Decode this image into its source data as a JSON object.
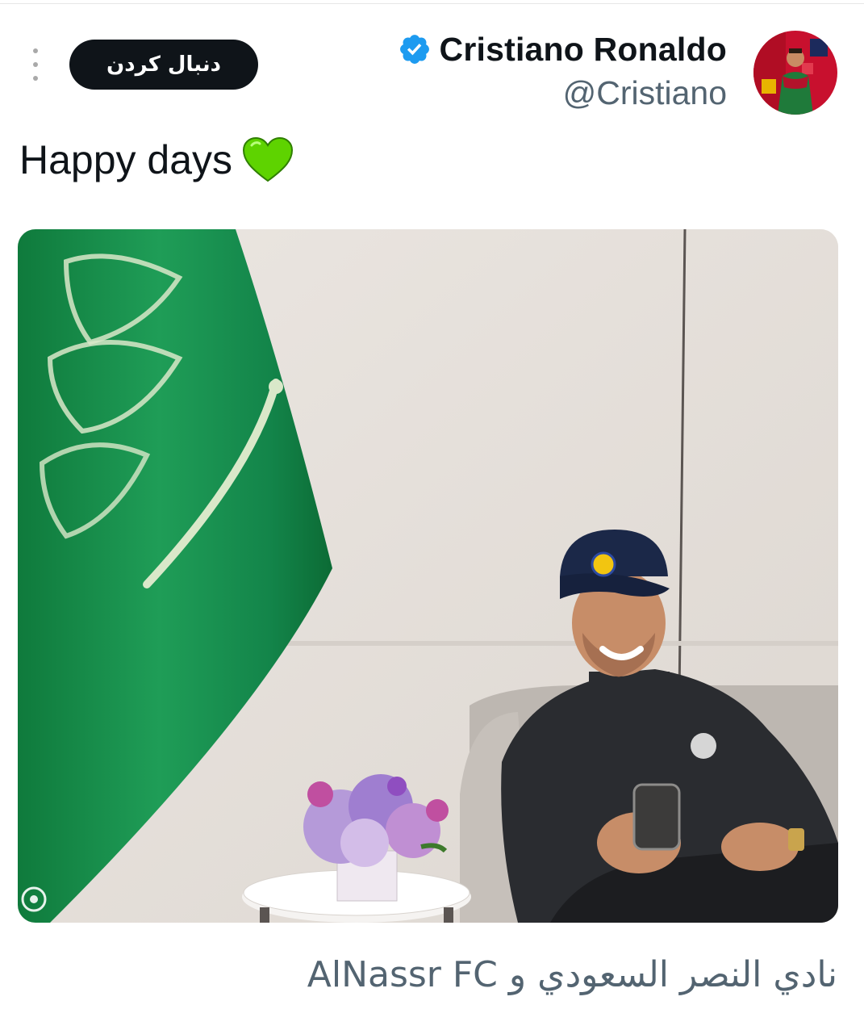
{
  "header": {
    "display_name": "Cristiano Ronaldo",
    "handle": "@Cristiano",
    "follow_label": "دنبال کردن",
    "verified": true,
    "avatar_icon": "avatar-image"
  },
  "tweet": {
    "text": "Happy days",
    "emoji_icon": "green-heart-icon",
    "media_icon": "photo-ronaldo-flag"
  },
  "caption": {
    "text": "نادي النصر السعودي و AlNassr FC"
  },
  "colors": {
    "verified_blue": "#1d9bf0",
    "follow_bg": "#0f1419",
    "heart_green": "#5ed300",
    "flag_green": "#1e9a55",
    "muted_text": "#536471"
  }
}
